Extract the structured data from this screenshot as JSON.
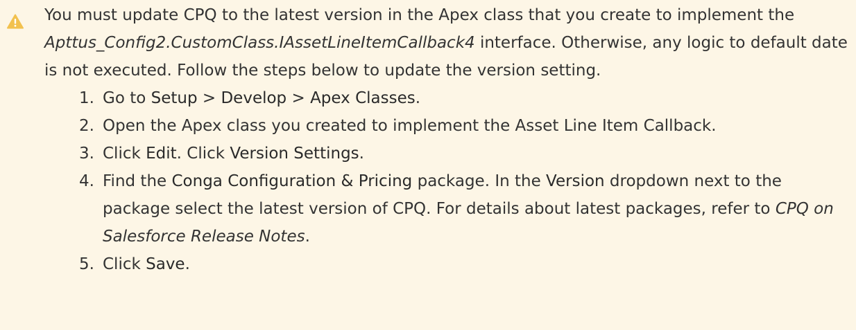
{
  "icon": {
    "name": "warning-icon",
    "color": "#f2c14e"
  },
  "intro": {
    "part1": "You must update CPQ to the latest version in the Apex class that you create to implement the ",
    "interface_name": "Apttus_Config2.CustomClass.IAssetLineItemCallback4",
    "part2": " interface. Otherwise, any logic to default date is not executed. Follow the steps below to update the version setting."
  },
  "steps": [
    {
      "num": "1.",
      "t1": "Go to ",
      "b1": "Setup",
      "t2": " > ",
      "b2": "Develop",
      "t3": " > ",
      "b3": "Apex Classes",
      "t4": "."
    },
    {
      "num": "2.",
      "text": "Open the Apex class you created to implement the Asset Line Item Callback."
    },
    {
      "num": "3.",
      "t1": "Click ",
      "b1": "Edit",
      "t2": ". Click ",
      "b2": "Version Settings",
      "t3": "."
    },
    {
      "num": "4.",
      "t1": "Find the ",
      "b1": "Conga Configuration & Pricing",
      "t2": " package. In the ",
      "b2": "Version",
      "t3": " dropdown next to the package select the latest version of CPQ. For details about latest packages, refer to ",
      "link": "CPQ on Salesforce Release Notes",
      "t4": "."
    },
    {
      "num": "5.",
      "t1": "Click ",
      "b1": "Save",
      "t2": "."
    }
  ]
}
